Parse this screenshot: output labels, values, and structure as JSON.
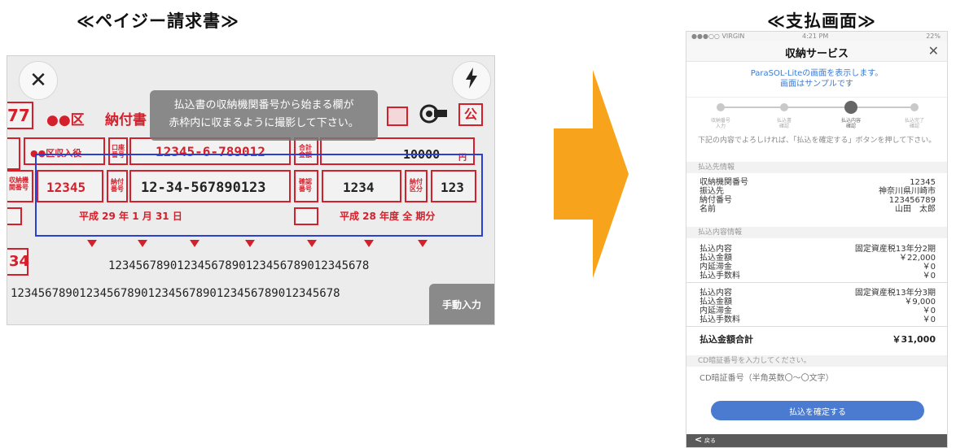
{
  "headings": {
    "left": "≪ペイジー請求書≫",
    "right": "≪支払画面≫"
  },
  "scanner": {
    "close_icon": "✕",
    "flash_icon": "ϟ",
    "tooltip_line1": "払込書の収納機関番号から始まる欄が",
    "tooltip_line2": "赤枠内に収まるように撮影して下さい。",
    "slip": {
      "partial_num": "77",
      "ward": "●●区",
      "title_partial": "納付書",
      "badge": "公",
      "payee_partial": "●●区収入役",
      "account": "12345-6-789012",
      "amount": "10000",
      "amount_unit": "円",
      "institution": "12345",
      "payment_no": "12-34-567890123",
      "confirm_no": "1234",
      "category": "123",
      "date_text": "平成 29 年 1 月 31 日",
      "period_text": "平成 28 年度 全 期分",
      "side_num": "34",
      "label_account": "口座番号",
      "label_total": "合計金額",
      "label_payno": "納付番号",
      "label_confirm": "確認番号",
      "label_category": "納付区分",
      "label_inst": "収納機関番号"
    },
    "barcode_line1": "12345678901234567890123456789012345678",
    "barcode_line2": "123456789012345678901234567890123456789012345678",
    "manual_button": "手動入力"
  },
  "phone": {
    "status_carrier": "●●●○○ VIRGIN",
    "status_time": "4:21 PM",
    "status_battery": "22%",
    "title": "収納サービス",
    "close_icon": "✕",
    "notice_line1": "ParaSOL-Liteの画面を表示します。",
    "notice_line2": "画面はサンプルです",
    "steps": [
      {
        "label1": "収納番号",
        "label2": "入力"
      },
      {
        "label1": "払込書",
        "label2": "確認"
      },
      {
        "label1": "払込内容",
        "label2": "確認"
      },
      {
        "label1": "払込完了",
        "label2": "確認"
      }
    ],
    "instructions": "下記の内容でよろしければ、「払込を確定する」ボタンを押して下さい。",
    "payee_header": "払込先情報",
    "payee_rows": [
      {
        "k": "収納機関番号",
        "v": "12345"
      },
      {
        "k": "振込先",
        "v": "神奈川県川崎市"
      },
      {
        "k": "納付番号",
        "v": "123456789"
      },
      {
        "k": "名前",
        "v": "山田　太郎"
      }
    ],
    "detail_header": "払込内容情報",
    "detail_group1": [
      {
        "k": "払込内容",
        "v": "固定資産税13年分2期"
      },
      {
        "k": "払込金額",
        "v": "￥22,000"
      },
      {
        "k": "内延滞金",
        "v": "￥0"
      },
      {
        "k": "払込手数料",
        "v": "￥0"
      }
    ],
    "detail_group2": [
      {
        "k": "払込内容",
        "v": "固定資産税13年分3期"
      },
      {
        "k": "払込金額",
        "v": "￥9,000"
      },
      {
        "k": "内延滞金",
        "v": "￥0"
      },
      {
        "k": "払込手数料",
        "v": "￥0"
      }
    ],
    "total_label": "払込金額合計",
    "total_value": "￥31,000",
    "pin_header": "CD暗証番号を入力してください。",
    "pin_placeholder": "CD暗証番号（半角英数〇〜〇文字）",
    "confirm_button": "払込を確定する",
    "back_icon": "<",
    "back_label": "戻る"
  },
  "colors": {
    "slip_red": "#d4202c",
    "scan_frame_blue": "#2a3fd6",
    "arrow_orange": "#f7a31c",
    "button_blue": "#4a7bd0"
  }
}
